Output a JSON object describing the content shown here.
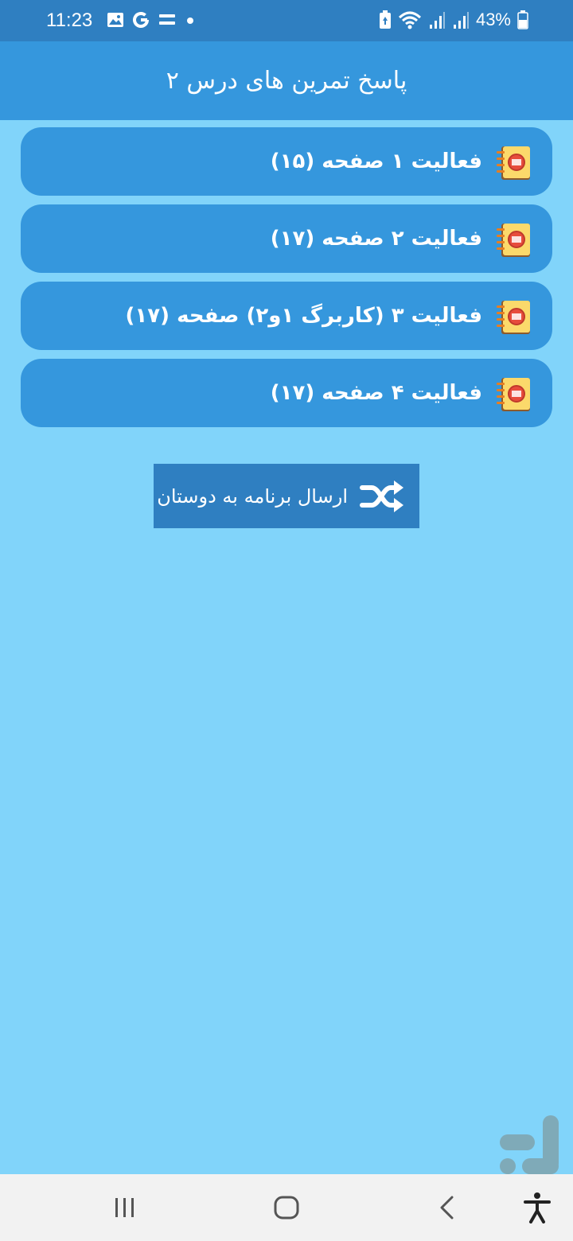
{
  "status_bar": {
    "time": "11:23",
    "battery": "43%",
    "icons_left": [
      "image-icon",
      "google-icon",
      "equals-icon",
      "dot-icon"
    ],
    "icons_right": [
      "battery-saver-icon",
      "wifi-icon",
      "signal-icon",
      "signal-icon",
      "battery-icon"
    ]
  },
  "app_bar": {
    "title": "پاسخ تمرین های درس ۲"
  },
  "list": {
    "items": [
      {
        "label": "فعالیت ۱ صفحه (۱۵)",
        "icon": "notebook-icon"
      },
      {
        "label": "فعالیت ۲ صفحه (۱۷)",
        "icon": "notebook-icon"
      },
      {
        "label": "فعالیت ۳ (کاربرگ ۱و۲) صفحه (۱۷)",
        "icon": "notebook-icon"
      },
      {
        "label": "فعالیت ۴ صفحه (۱۷)",
        "icon": "notebook-icon"
      }
    ]
  },
  "share_button": {
    "label": "ارسال برنامه به دوستان",
    "icon": "shuffle-icon"
  },
  "nav_bar": {
    "icons": [
      "recents-icon",
      "home-icon",
      "back-icon",
      "accessibility-icon"
    ]
  },
  "colors": {
    "status_bar": "#2f7fc1",
    "app_bar": "#3597dd",
    "background": "#81d4fa",
    "list_item": "#3597dd",
    "button": "#2f7fc1",
    "nav_bar": "#f2f2f2"
  }
}
